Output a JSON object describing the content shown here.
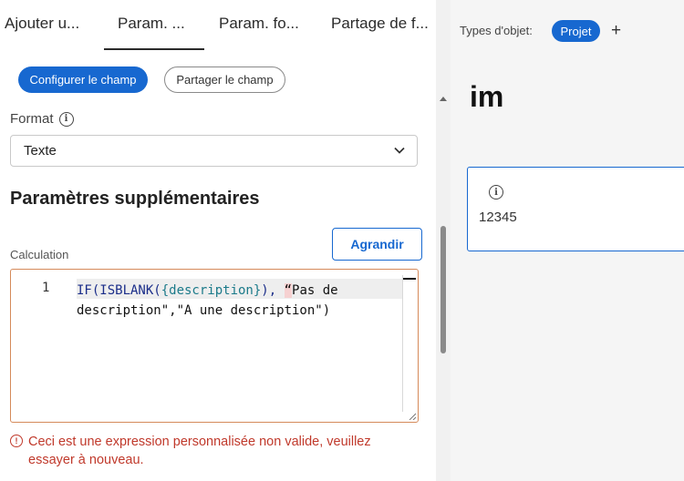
{
  "tabs": [
    {
      "label": "Ajouter u..."
    },
    {
      "label": "Param. ..."
    },
    {
      "label": "Param. fo..."
    },
    {
      "label": "Partage de f..."
    }
  ],
  "actions": {
    "configure_label": "Configurer le champ",
    "share_label": "Partager le champ"
  },
  "format": {
    "label": "Format",
    "selected": "Texte"
  },
  "extra": {
    "section_title": "Paramètres supplémentaires",
    "calc_label": "Calculation",
    "expand_label": "Agrandir"
  },
  "editor": {
    "line_number": "1",
    "code_fn": "IF(ISBLANK(",
    "code_field": "{description}",
    "code_mid": "), ",
    "code_err": "“",
    "code_rest": "Pas de description\",\"A une description\")"
  },
  "error": {
    "message": "Ceci est une expression personnalisée non valide, veuillez essayer à nouveau."
  },
  "right": {
    "types_label": "Types d'objet:",
    "type_badge": "Projet",
    "add_symbol": "+",
    "title": "im",
    "card_value": "12345"
  },
  "colors": {
    "accent": "#1768d0",
    "error": "#c0392b",
    "editor_border": "#d58a5a"
  }
}
